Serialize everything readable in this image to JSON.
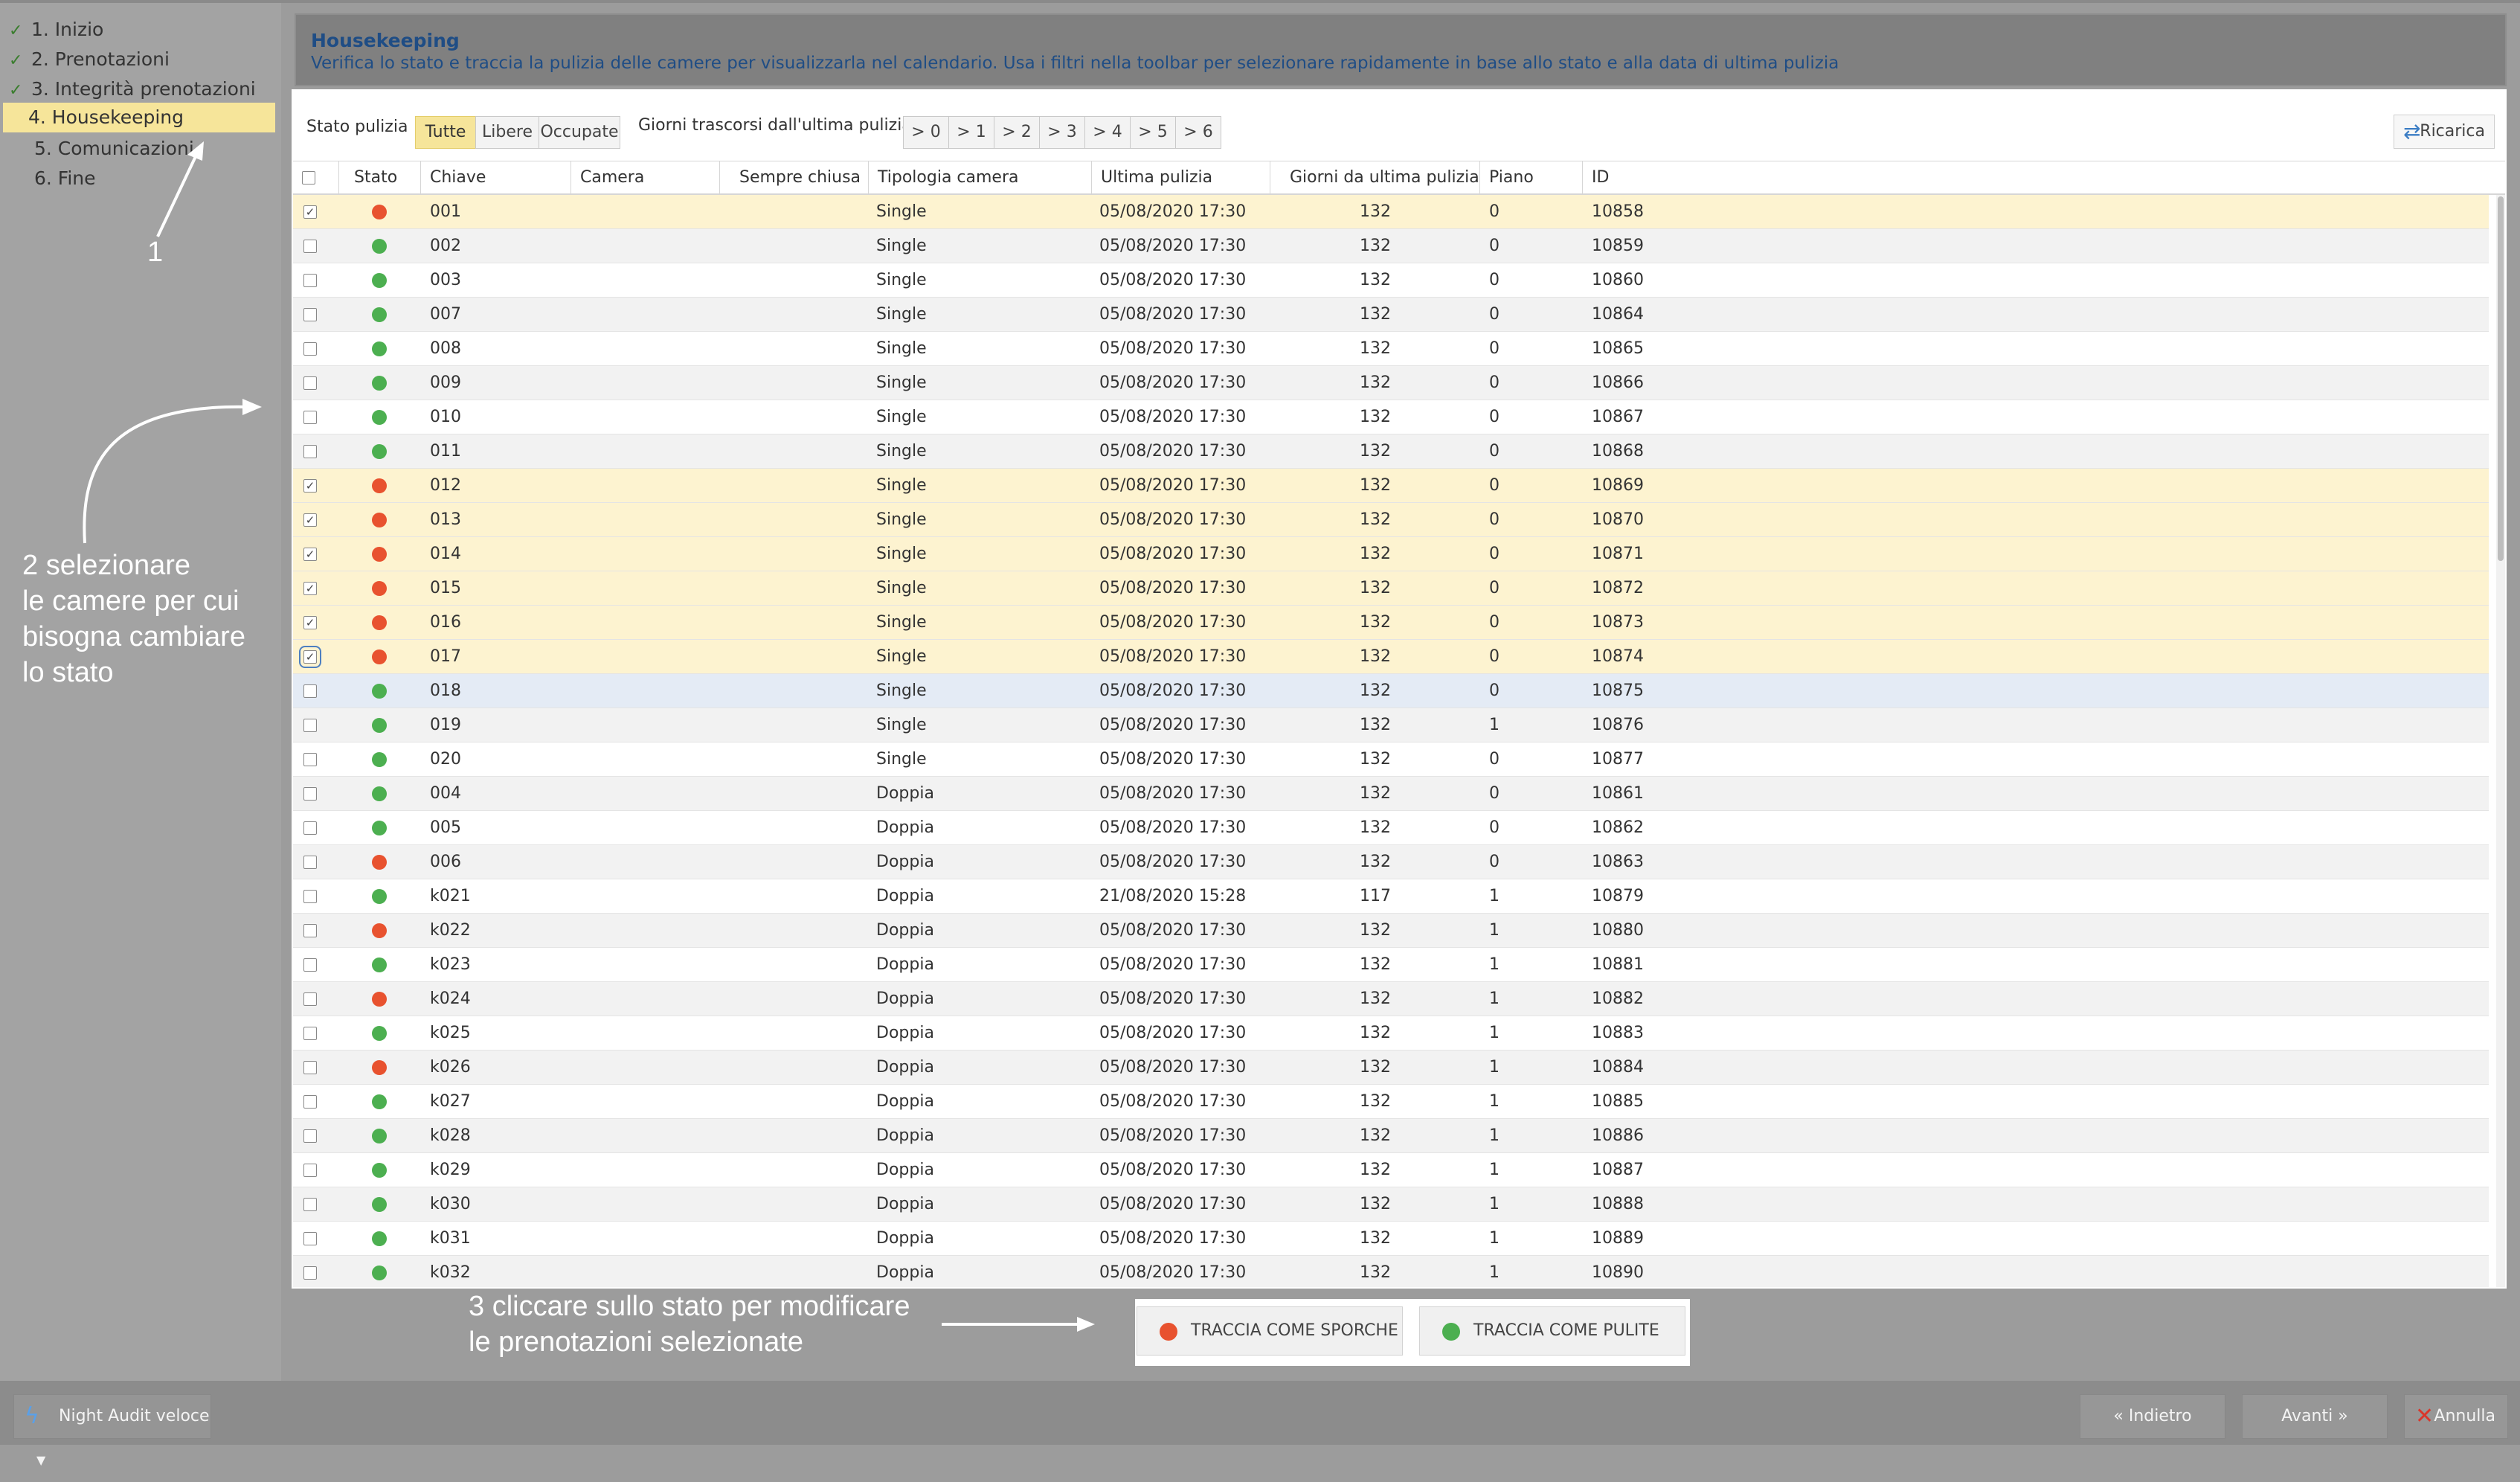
{
  "steps": [
    {
      "label": "1. Inizio",
      "done": true
    },
    {
      "label": "2. Prenotazioni",
      "done": true
    },
    {
      "label": "3. Integrità prenotazioni",
      "done": true
    },
    {
      "label": "4. Housekeeping",
      "done": false,
      "active": true
    },
    {
      "label": "5. Comunicazioni",
      "done": false
    },
    {
      "label": "6. Fine",
      "done": false
    }
  ],
  "annotations": {
    "a1": "1",
    "a2": [
      "2 selezionare",
      "le camere per cui",
      "bisogna cambiare",
      "lo stato"
    ],
    "a3": [
      "3 cliccare sullo stato per modificare",
      "le prenotazioni selezionate"
    ]
  },
  "header": {
    "title": "Housekeeping",
    "description": "Verifica lo stato e traccia la pulizia delle camere per visualizzarla nel calendario. Usa i filtri nella toolbar per selezionare rapidamente in base allo stato e alla data di ultima pulizia"
  },
  "toolbar": {
    "status_label": "Stato pulizia",
    "status_options": [
      "Tutte",
      "Libere",
      "Occupate"
    ],
    "status_selected": "Tutte",
    "days_label": "Giorni trascorsi dall'ultima pulizia",
    "days_options": [
      "> 0",
      "> 1",
      "> 2",
      "> 3",
      "> 4",
      "> 5",
      "> 6"
    ],
    "reload_label": "Ricarica"
  },
  "columns": [
    "Stato",
    "Chiave",
    "Camera occupata",
    "Sempre chiusa",
    "Tipologia camera",
    "Ultima pulizia",
    "Giorni da ultima pulizia",
    "Piano",
    "ID"
  ],
  "status_colors": {
    "dirty": "#e8522f",
    "clean": "#4caf50"
  },
  "rows": [
    {
      "checked": true,
      "status": "dirty",
      "key": "001",
      "type": "Single",
      "last": "05/08/2020 17:30",
      "days": "132",
      "floor": "0",
      "id": "10858"
    },
    {
      "checked": false,
      "status": "clean",
      "key": "002",
      "type": "Single",
      "last": "05/08/2020 17:30",
      "days": "132",
      "floor": "0",
      "id": "10859"
    },
    {
      "checked": false,
      "status": "clean",
      "key": "003",
      "type": "Single",
      "last": "05/08/2020 17:30",
      "days": "132",
      "floor": "0",
      "id": "10860"
    },
    {
      "checked": false,
      "status": "clean",
      "key": "007",
      "type": "Single",
      "last": "05/08/2020 17:30",
      "days": "132",
      "floor": "0",
      "id": "10864"
    },
    {
      "checked": false,
      "status": "clean",
      "key": "008",
      "type": "Single",
      "last": "05/08/2020 17:30",
      "days": "132",
      "floor": "0",
      "id": "10865"
    },
    {
      "checked": false,
      "status": "clean",
      "key": "009",
      "type": "Single",
      "last": "05/08/2020 17:30",
      "days": "132",
      "floor": "0",
      "id": "10866"
    },
    {
      "checked": false,
      "status": "clean",
      "key": "010",
      "type": "Single",
      "last": "05/08/2020 17:30",
      "days": "132",
      "floor": "0",
      "id": "10867"
    },
    {
      "checked": false,
      "status": "clean",
      "key": "011",
      "type": "Single",
      "last": "05/08/2020 17:30",
      "days": "132",
      "floor": "0",
      "id": "10868"
    },
    {
      "checked": true,
      "status": "dirty",
      "key": "012",
      "type": "Single",
      "last": "05/08/2020 17:30",
      "days": "132",
      "floor": "0",
      "id": "10869"
    },
    {
      "checked": true,
      "status": "dirty",
      "key": "013",
      "type": "Single",
      "last": "05/08/2020 17:30",
      "days": "132",
      "floor": "0",
      "id": "10870"
    },
    {
      "checked": true,
      "status": "dirty",
      "key": "014",
      "type": "Single",
      "last": "05/08/2020 17:30",
      "days": "132",
      "floor": "0",
      "id": "10871"
    },
    {
      "checked": true,
      "status": "dirty",
      "key": "015",
      "type": "Single",
      "last": "05/08/2020 17:30",
      "days": "132",
      "floor": "0",
      "id": "10872"
    },
    {
      "checked": true,
      "status": "dirty",
      "key": "016",
      "type": "Single",
      "last": "05/08/2020 17:30",
      "days": "132",
      "floor": "0",
      "id": "10873"
    },
    {
      "checked": true,
      "status": "dirty",
      "key": "017",
      "type": "Single",
      "last": "05/08/2020 17:30",
      "days": "132",
      "floor": "0",
      "id": "10874",
      "focus": true
    },
    {
      "checked": false,
      "status": "clean",
      "key": "018",
      "type": "Single",
      "last": "05/08/2020 17:30",
      "days": "132",
      "floor": "0",
      "id": "10875",
      "hover": true
    },
    {
      "checked": false,
      "status": "clean",
      "key": "019",
      "type": "Single",
      "last": "05/08/2020 17:30",
      "days": "132",
      "floor": "1",
      "id": "10876"
    },
    {
      "checked": false,
      "status": "clean",
      "key": "020",
      "type": "Single",
      "last": "05/08/2020 17:30",
      "days": "132",
      "floor": "0",
      "id": "10877"
    },
    {
      "checked": false,
      "status": "clean",
      "key": "004",
      "type": "Doppia",
      "last": "05/08/2020 17:30",
      "days": "132",
      "floor": "0",
      "id": "10861"
    },
    {
      "checked": false,
      "status": "clean",
      "key": "005",
      "type": "Doppia",
      "last": "05/08/2020 17:30",
      "days": "132",
      "floor": "0",
      "id": "10862"
    },
    {
      "checked": false,
      "status": "dirty",
      "key": "006",
      "type": "Doppia",
      "last": "05/08/2020 17:30",
      "days": "132",
      "floor": "0",
      "id": "10863"
    },
    {
      "checked": false,
      "status": "clean",
      "key": "k021",
      "type": "Doppia",
      "last": "21/08/2020 15:28",
      "days": "117",
      "floor": "1",
      "id": "10879"
    },
    {
      "checked": false,
      "status": "dirty",
      "key": "k022",
      "type": "Doppia",
      "last": "05/08/2020 17:30",
      "days": "132",
      "floor": "1",
      "id": "10880"
    },
    {
      "checked": false,
      "status": "clean",
      "key": "k023",
      "type": "Doppia",
      "last": "05/08/2020 17:30",
      "days": "132",
      "floor": "1",
      "id": "10881"
    },
    {
      "checked": false,
      "status": "dirty",
      "key": "k024",
      "type": "Doppia",
      "last": "05/08/2020 17:30",
      "days": "132",
      "floor": "1",
      "id": "10882"
    },
    {
      "checked": false,
      "status": "clean",
      "key": "k025",
      "type": "Doppia",
      "last": "05/08/2020 17:30",
      "days": "132",
      "floor": "1",
      "id": "10883"
    },
    {
      "checked": false,
      "status": "dirty",
      "key": "k026",
      "type": "Doppia",
      "last": "05/08/2020 17:30",
      "days": "132",
      "floor": "1",
      "id": "10884"
    },
    {
      "checked": false,
      "status": "clean",
      "key": "k027",
      "type": "Doppia",
      "last": "05/08/2020 17:30",
      "days": "132",
      "floor": "1",
      "id": "10885"
    },
    {
      "checked": false,
      "status": "clean",
      "key": "k028",
      "type": "Doppia",
      "last": "05/08/2020 17:30",
      "days": "132",
      "floor": "1",
      "id": "10886"
    },
    {
      "checked": false,
      "status": "clean",
      "key": "k029",
      "type": "Doppia",
      "last": "05/08/2020 17:30",
      "days": "132",
      "floor": "1",
      "id": "10887"
    },
    {
      "checked": false,
      "status": "clean",
      "key": "k030",
      "type": "Doppia",
      "last": "05/08/2020 17:30",
      "days": "132",
      "floor": "1",
      "id": "10888"
    },
    {
      "checked": false,
      "status": "clean",
      "key": "k031",
      "type": "Doppia",
      "last": "05/08/2020 17:30",
      "days": "132",
      "floor": "1",
      "id": "10889"
    },
    {
      "checked": false,
      "status": "clean",
      "key": "k032",
      "type": "Doppia",
      "last": "05/08/2020 17:30",
      "days": "132",
      "floor": "1",
      "id": "10890"
    }
  ],
  "actions": {
    "mark_dirty": "TRACCIA COME SPORCHE",
    "mark_clean": "TRACCIA COME PULITE"
  },
  "footer": {
    "night_audit": "Night Audit veloce",
    "back": "« Indietro",
    "next": "Avanti »",
    "cancel": "Annulla"
  }
}
